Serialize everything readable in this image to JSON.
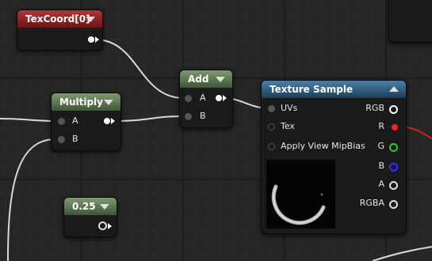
{
  "nodes": {
    "texcoord": {
      "title": "TexCoord[0]",
      "color": "#9a2a2a"
    },
    "multiply": {
      "title": "Multiply",
      "pin_a": "A",
      "pin_b": "B"
    },
    "add": {
      "title": "Add",
      "pin_a": "A",
      "pin_b": "B"
    },
    "constant": {
      "title": "0.25"
    },
    "texture_sample": {
      "title": "Texture Sample",
      "inputs": [
        "UVs",
        "Tex",
        "Apply View MipBias"
      ],
      "outputs": [
        {
          "label": "RGB",
          "color": "#ffffff"
        },
        {
          "label": "R",
          "color": "#ff2020"
        },
        {
          "label": "G",
          "color": "#20d020"
        },
        {
          "label": "B",
          "color": "#3030ff"
        },
        {
          "label": "A",
          "color": "#cccccc"
        },
        {
          "label": "RGBA",
          "color": "#cccccc"
        }
      ]
    }
  }
}
